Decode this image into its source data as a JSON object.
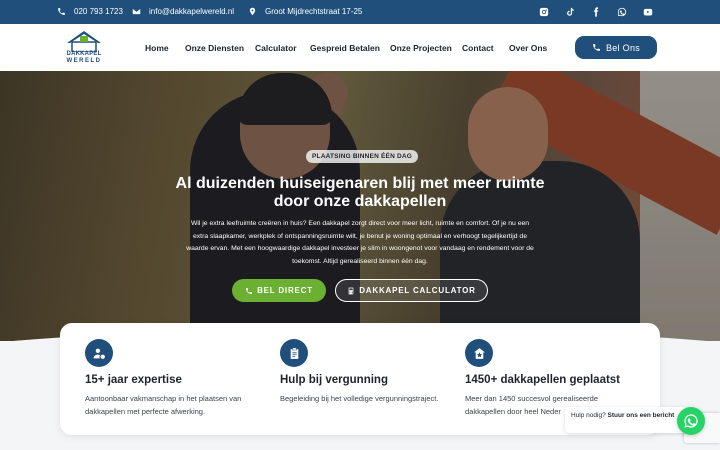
{
  "topbar": {
    "phone": "020 793 1723",
    "email": "info@dakkapelwereld.nl",
    "address": "Groot Mijdrechtstraat 17-25",
    "social": [
      "instagram-icon",
      "tiktok-icon",
      "facebook-icon",
      "whatsapp-icon",
      "youtube-icon"
    ]
  },
  "header": {
    "logo_line1": "DAKKAPEL",
    "logo_line2": "WERELD",
    "nav": [
      "Home",
      "Onze Diensten",
      "Calculator",
      "Gespreid Betalen",
      "Onze Projecten",
      "Contact",
      "Over Ons"
    ],
    "cta": "Bel Ons"
  },
  "hero": {
    "badge": "PLAATSING BINNEN ÉÉN DAG",
    "title": "Al duizenden huiseigenaren blij met meer ruimte door onze dakkapellen",
    "text": "Wil je extra leefruimte creëren in huis? Een dakkapel zorgt direct voor meer licht, ruimte en comfort. Of je nu een extra slaapkamer, werkplek of ontspanningsruimte wilt, je benut je woning optimaal en verhoogt tegelijkertijd de waarde ervan. Met een hoogwaardige dakkapel investeer je slim in woongenot voor vandaag en rendement voor de toekomst. Altijd gerealiseerd binnen één dag.",
    "btn_direct": "BEL DIRECT",
    "btn_calc": "DAKKAPEL CALCULATOR"
  },
  "features": [
    {
      "icon": "user-gear-icon",
      "title": "15+ jaar expertise",
      "desc": "Aantoonbaar vakmanschap in het plaatsen van dakkapellen met perfecte afwerking."
    },
    {
      "icon": "clipboard-icon",
      "title": "Hulp bij vergunning",
      "desc": "Begeleiding bij het volledige vergunningstraject."
    },
    {
      "icon": "house-star-icon",
      "title": "1450+ dakkapellen geplaatst",
      "desc": "Meer dan 1450 succesvol gerealiseerde dakkapellen door heel Neder"
    }
  ],
  "whatsapp": {
    "prefix": "Hulp nodig?",
    "bold": "Stuur ons een bericht"
  },
  "colors": {
    "primary": "#1f4f7a",
    "green": "#6bb033",
    "whatsapp": "#25d366"
  }
}
